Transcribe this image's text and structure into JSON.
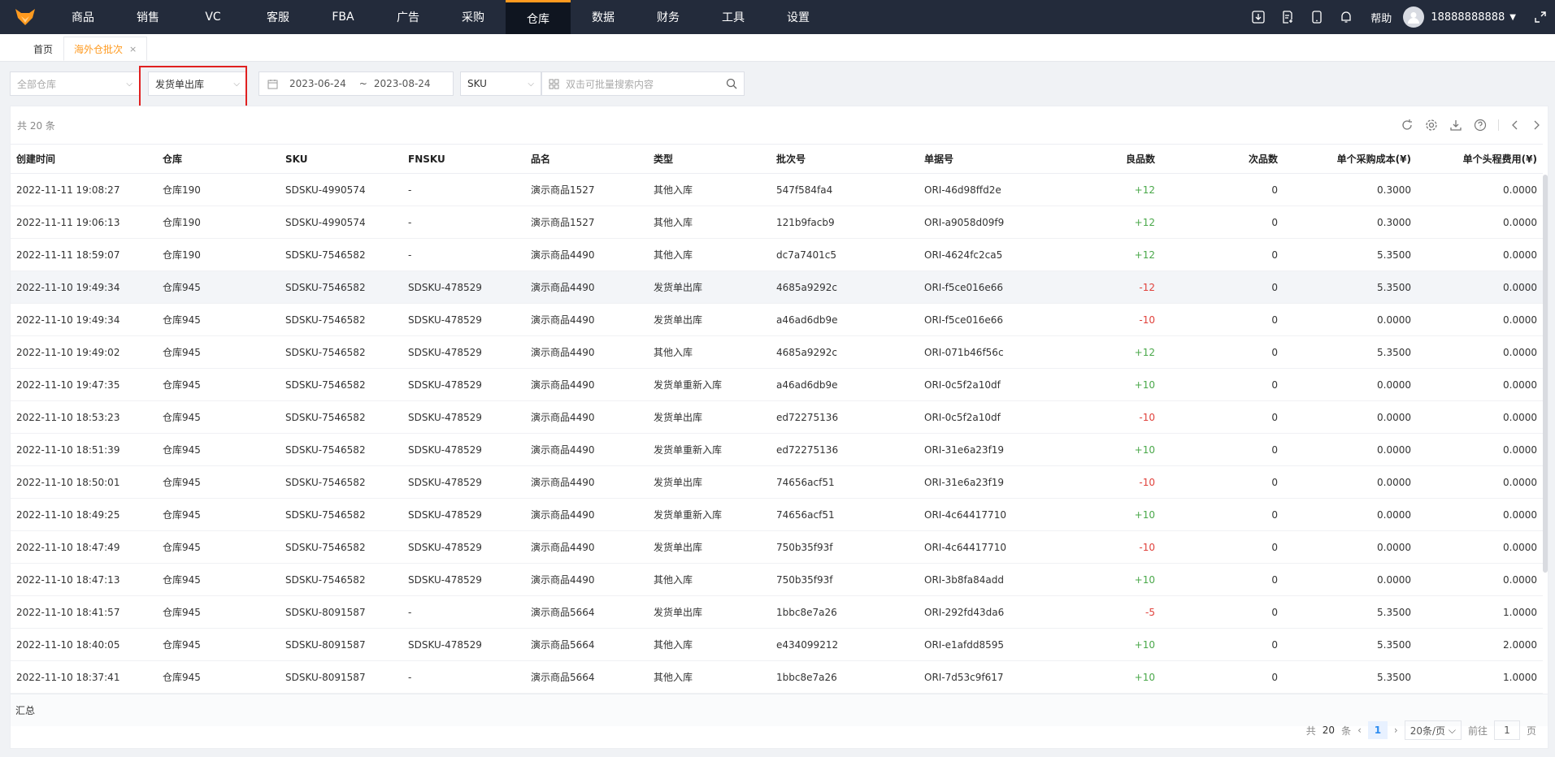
{
  "nav": {
    "items": [
      "商品",
      "销售",
      "VC",
      "客服",
      "FBA",
      "广告",
      "采购",
      "仓库",
      "数据",
      "财务",
      "工具",
      "设置"
    ],
    "active_index": 7,
    "help": "帮助",
    "user": "18888888888"
  },
  "tabs": [
    {
      "label": "首页",
      "active": false
    },
    {
      "label": "海外仓批次",
      "active": true,
      "close": "×"
    }
  ],
  "filters": {
    "warehouse_placeholder": "全部仓库",
    "type_value": "发货单出库",
    "date_start": "2023-06-24",
    "date_sep": "~",
    "date_end": "2023-08-24",
    "field_value": "SKU",
    "search_placeholder": "双击可批量搜索内容"
  },
  "total_text": "共 20 条",
  "columns": [
    "创建时间",
    "仓库",
    "SKU",
    "FNSKU",
    "品名",
    "类型",
    "批次号",
    "单据号",
    "良品数",
    "次品数",
    "单个采购成本(¥)",
    "单个头程费用(¥)"
  ],
  "rows": [
    [
      "2022-11-11 19:08:27",
      "仓库190",
      "SDSKU-4990574",
      "-",
      "演示商品1527",
      "其他入库",
      "547f584fa4",
      "ORI-46d98ffd2e",
      "+12",
      "0",
      "0.3000",
      "0.0000"
    ],
    [
      "2022-11-11 19:06:13",
      "仓库190",
      "SDSKU-4990574",
      "-",
      "演示商品1527",
      "其他入库",
      "121b9facb9",
      "ORI-a9058d09f9",
      "+12",
      "0",
      "0.3000",
      "0.0000"
    ],
    [
      "2022-11-11 18:59:07",
      "仓库190",
      "SDSKU-7546582",
      "-",
      "演示商品4490",
      "其他入库",
      "dc7a7401c5",
      "ORI-4624fc2ca5",
      "+12",
      "0",
      "5.3500",
      "0.0000"
    ],
    [
      "2022-11-10 19:49:34",
      "仓库945",
      "SDSKU-7546582",
      "SDSKU-478529",
      "演示商品4490",
      "发货单出库",
      "4685a9292c",
      "ORI-f5ce016e66",
      "-12",
      "0",
      "5.3500",
      "0.0000"
    ],
    [
      "2022-11-10 19:49:34",
      "仓库945",
      "SDSKU-7546582",
      "SDSKU-478529",
      "演示商品4490",
      "发货单出库",
      "a46ad6db9e",
      "ORI-f5ce016e66",
      "-10",
      "0",
      "0.0000",
      "0.0000"
    ],
    [
      "2022-11-10 19:49:02",
      "仓库945",
      "SDSKU-7546582",
      "SDSKU-478529",
      "演示商品4490",
      "其他入库",
      "4685a9292c",
      "ORI-071b46f56c",
      "+12",
      "0",
      "5.3500",
      "0.0000"
    ],
    [
      "2022-11-10 19:47:35",
      "仓库945",
      "SDSKU-7546582",
      "SDSKU-478529",
      "演示商品4490",
      "发货单重新入库",
      "a46ad6db9e",
      "ORI-0c5f2a10df",
      "+10",
      "0",
      "0.0000",
      "0.0000"
    ],
    [
      "2022-11-10 18:53:23",
      "仓库945",
      "SDSKU-7546582",
      "SDSKU-478529",
      "演示商品4490",
      "发货单出库",
      "ed72275136",
      "ORI-0c5f2a10df",
      "-10",
      "0",
      "0.0000",
      "0.0000"
    ],
    [
      "2022-11-10 18:51:39",
      "仓库945",
      "SDSKU-7546582",
      "SDSKU-478529",
      "演示商品4490",
      "发货单重新入库",
      "ed72275136",
      "ORI-31e6a23f19",
      "+10",
      "0",
      "0.0000",
      "0.0000"
    ],
    [
      "2022-11-10 18:50:01",
      "仓库945",
      "SDSKU-7546582",
      "SDSKU-478529",
      "演示商品4490",
      "发货单出库",
      "74656acf51",
      "ORI-31e6a23f19",
      "-10",
      "0",
      "0.0000",
      "0.0000"
    ],
    [
      "2022-11-10 18:49:25",
      "仓库945",
      "SDSKU-7546582",
      "SDSKU-478529",
      "演示商品4490",
      "发货单重新入库",
      "74656acf51",
      "ORI-4c64417710",
      "+10",
      "0",
      "0.0000",
      "0.0000"
    ],
    [
      "2022-11-10 18:47:49",
      "仓库945",
      "SDSKU-7546582",
      "SDSKU-478529",
      "演示商品4490",
      "发货单出库",
      "750b35f93f",
      "ORI-4c64417710",
      "-10",
      "0",
      "0.0000",
      "0.0000"
    ],
    [
      "2022-11-10 18:47:13",
      "仓库945",
      "SDSKU-7546582",
      "SDSKU-478529",
      "演示商品4490",
      "其他入库",
      "750b35f93f",
      "ORI-3b8fa84add",
      "+10",
      "0",
      "0.0000",
      "0.0000"
    ],
    [
      "2022-11-10 18:41:57",
      "仓库945",
      "SDSKU-8091587",
      "-",
      "演示商品5664",
      "发货单出库",
      "1bbc8e7a26",
      "ORI-292fd43da6",
      "-5",
      "0",
      "5.3500",
      "1.0000"
    ],
    [
      "2022-11-10 18:40:05",
      "仓库945",
      "SDSKU-8091587",
      "SDSKU-478529",
      "演示商品5664",
      "其他入库",
      "e434099212",
      "ORI-e1afdd8595",
      "+10",
      "0",
      "5.3500",
      "2.0000"
    ],
    [
      "2022-11-10 18:37:41",
      "仓库945",
      "SDSKU-8091587",
      "-",
      "演示商品5664",
      "其他入库",
      "1bbc8e7a26",
      "ORI-7d53c9f617",
      "+10",
      "0",
      "5.3500",
      "1.0000"
    ]
  ],
  "summary_label": "汇总",
  "pager": {
    "total_prefix": "共",
    "total": "20",
    "total_suffix": "条",
    "current": "1",
    "page_size": "20条/页",
    "goto_label": "前往",
    "goto_value": "1",
    "goto_suffix": "页"
  },
  "colors": {
    "accent": "#ff9a1f",
    "nav_bg": "#232b3b",
    "positive": "#4aa84a",
    "negative": "#e0413b",
    "highlight_box": "#e02020"
  }
}
